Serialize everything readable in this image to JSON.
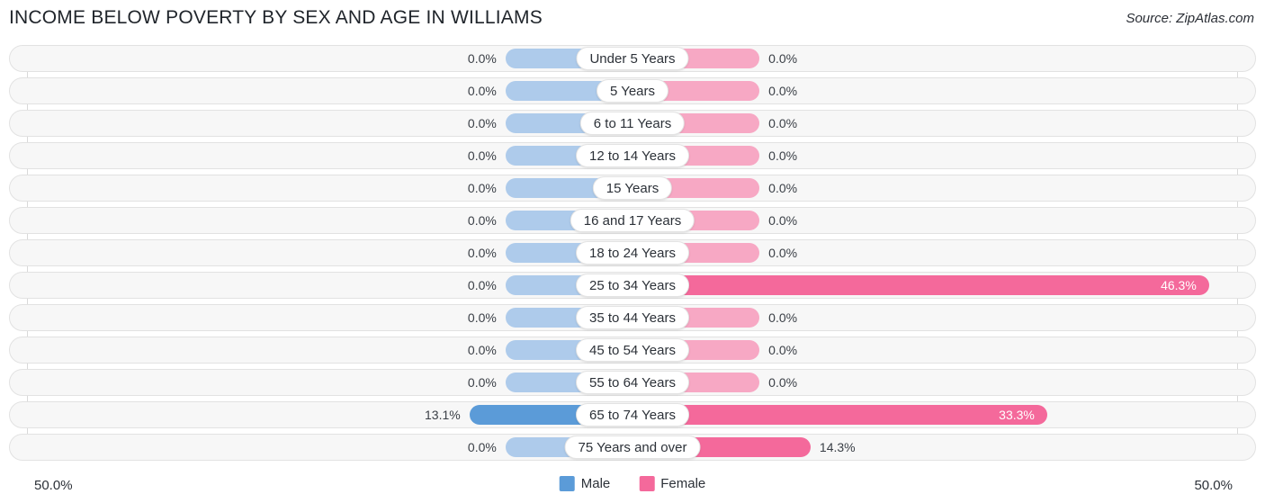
{
  "header": {
    "title": "INCOME BELOW POVERTY BY SEX AND AGE IN WILLIAMS",
    "source": "Source: ZipAtlas.com"
  },
  "footer": {
    "axis_left": "50.0%",
    "axis_right": "50.0%",
    "legend": [
      {
        "label": "Male",
        "color": "#5b9bd8"
      },
      {
        "label": "Female",
        "color": "#f4699b"
      }
    ]
  },
  "colors": {
    "male_zero": "#aecbeb",
    "male_value": "#5b9bd8",
    "female_zero": "#f7a8c4",
    "female_value": "#f4699b",
    "row_track": "#f7f7f7",
    "gridline": "#d9d9d9"
  },
  "chart_data": {
    "type": "bar",
    "title": "INCOME BELOW POVERTY BY SEX AND AGE IN WILLIAMS",
    "subtitle": "",
    "xlabel": "",
    "ylabel": "",
    "orientation": "horizontal-diverging",
    "axis_max_percent": 50.0,
    "xlim": [
      -50.0,
      50.0
    ],
    "grid": true,
    "legend_position": "bottom-center",
    "categories": [
      "Under 5 Years",
      "5 Years",
      "6 to 11 Years",
      "12 to 14 Years",
      "15 Years",
      "16 and 17 Years",
      "18 to 24 Years",
      "25 to 34 Years",
      "35 to 44 Years",
      "45 to 54 Years",
      "55 to 64 Years",
      "65 to 74 Years",
      "75 Years and over"
    ],
    "series": [
      {
        "name": "Male",
        "values": [
          0.0,
          0.0,
          0.0,
          0.0,
          0.0,
          0.0,
          0.0,
          0.0,
          0.0,
          0.0,
          0.0,
          13.1,
          0.0
        ],
        "labels": [
          "0.0%",
          "0.0%",
          "0.0%",
          "0.0%",
          "0.0%",
          "0.0%",
          "0.0%",
          "0.0%",
          "0.0%",
          "0.0%",
          "0.0%",
          "13.1%",
          "0.0%"
        ]
      },
      {
        "name": "Female",
        "values": [
          0.0,
          0.0,
          0.0,
          0.0,
          0.0,
          0.0,
          0.0,
          46.3,
          0.0,
          0.0,
          0.0,
          33.3,
          14.3
        ],
        "labels": [
          "0.0%",
          "0.0%",
          "0.0%",
          "0.0%",
          "0.0%",
          "0.0%",
          "0.0%",
          "46.3%",
          "0.0%",
          "0.0%",
          "0.0%",
          "33.3%",
          "14.3%"
        ]
      }
    ]
  }
}
